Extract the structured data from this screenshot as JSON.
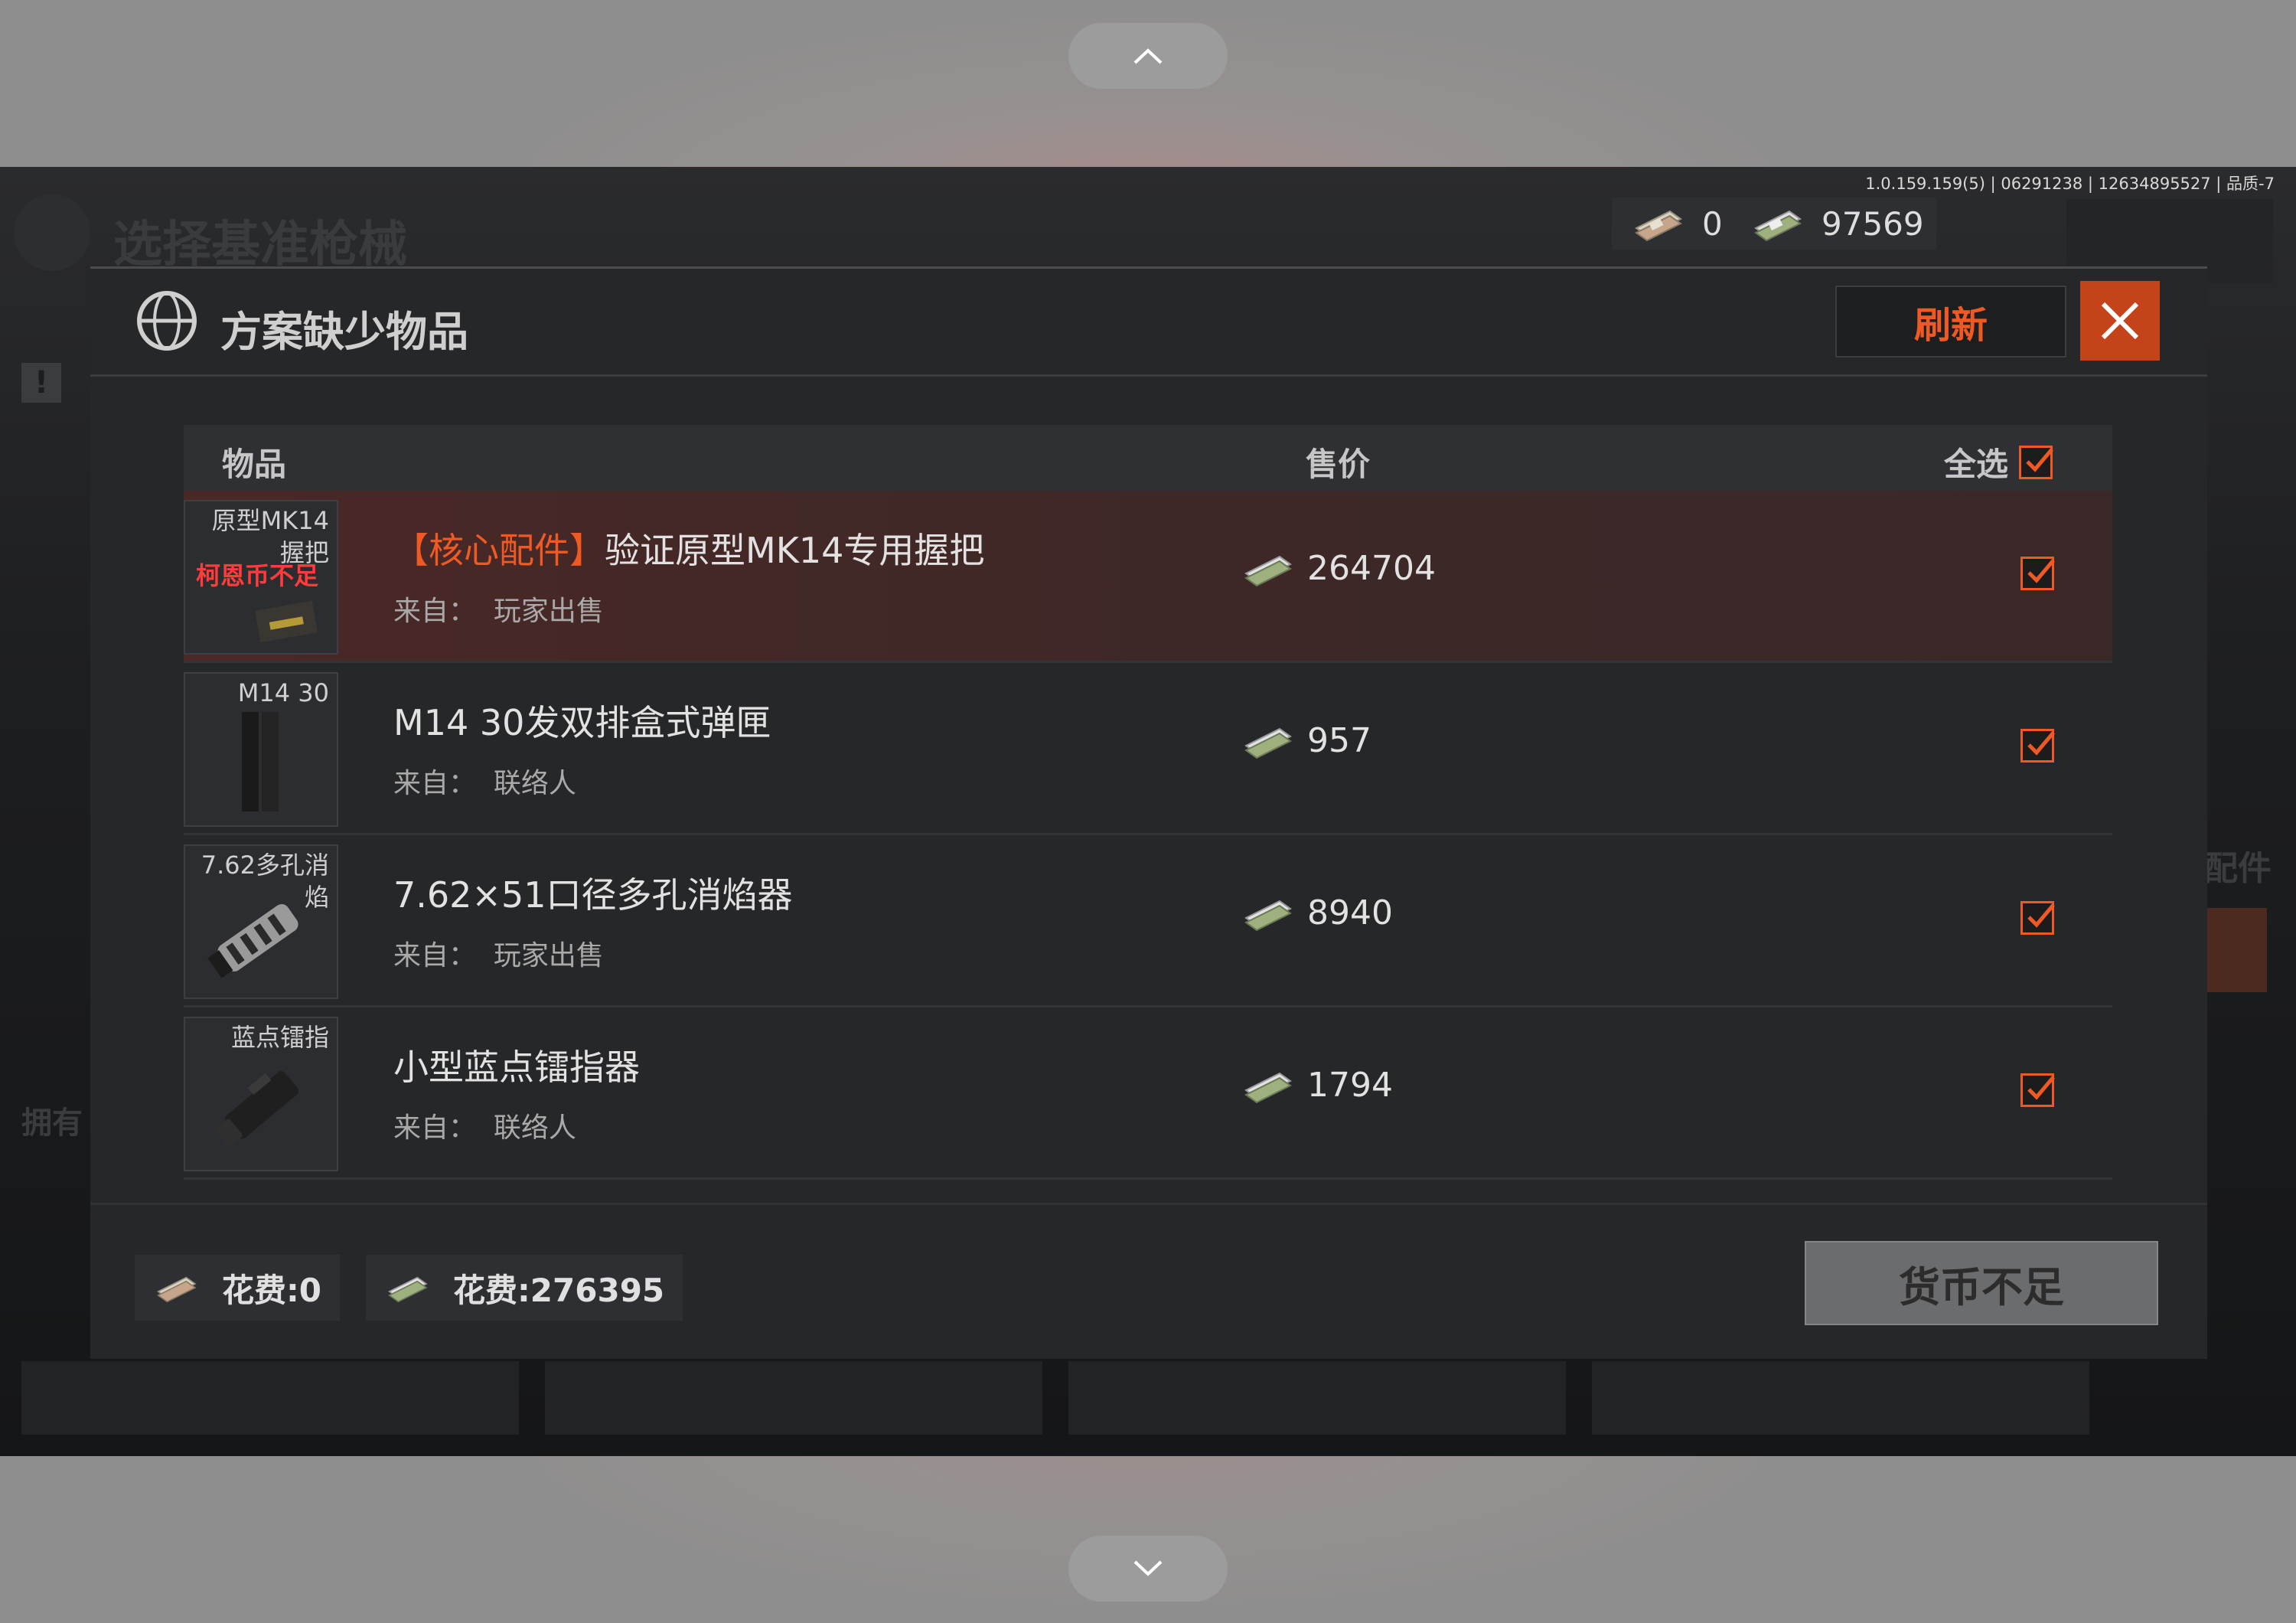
{
  "scroll": {
    "up_icon": "chevron-up-icon",
    "down_icon": "chevron-down-icon"
  },
  "background": {
    "title": "选择基准枪械",
    "side_label": "配件",
    "owned_label": "拥有",
    "version": "1.0.159.159(5) | 06291238 | 12634895527 | 品质-7"
  },
  "currency": {
    "coins": "0",
    "money": "97569"
  },
  "dialog": {
    "title": "方案缺少物品",
    "refresh_label": "刷新",
    "close_icon": "close-icon",
    "header": {
      "item": "物品",
      "price": "售价",
      "select_all": "全选",
      "select_all_checked": true
    },
    "items": [
      {
        "thumb_label": "原型MK14握把",
        "warning": "柯恩币不足",
        "core_tag": "【核心配件】",
        "name": "验证原型MK14专用握把",
        "source_label": "来自：",
        "source": "玩家出售",
        "price": "264704",
        "checked": true
      },
      {
        "thumb_label": "M14 30",
        "warning": "",
        "core_tag": "",
        "name": "M14 30发双排盒式弹匣",
        "source_label": "来自：",
        "source": "联络人",
        "price": "957",
        "checked": true
      },
      {
        "thumb_label": "7.62多孔消焰",
        "warning": "",
        "core_tag": "",
        "name": "7.62×51口径多孔消焰器",
        "source_label": "来自：",
        "source": "玩家出售",
        "price": "8940",
        "checked": true
      },
      {
        "thumb_label": "蓝点镭指",
        "warning": "",
        "core_tag": "",
        "name": "小型蓝点镭指器",
        "source_label": "来自：",
        "source": "联络人",
        "price": "1794",
        "checked": true
      }
    ],
    "cost_coins": "花费:0",
    "cost_money": "花费:276395",
    "insufficient_label": "货币不足"
  },
  "colors": {
    "accent": "#ef5a24",
    "warning": "#ff3b3b",
    "close_bg": "#c5431a"
  }
}
